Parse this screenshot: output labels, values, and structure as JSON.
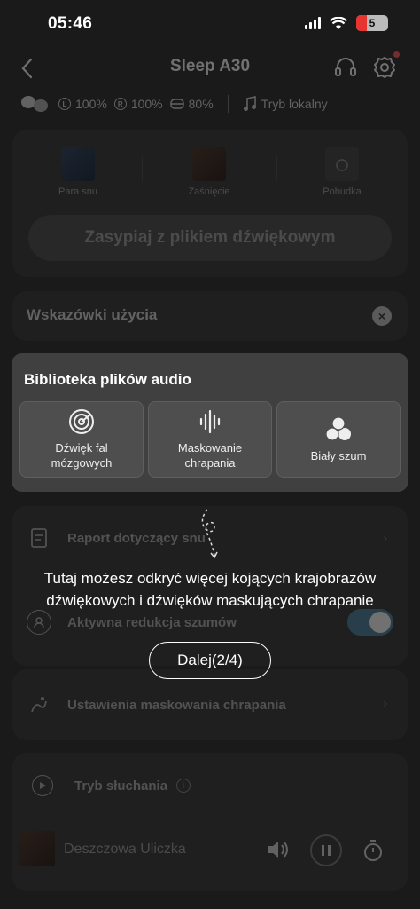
{
  "status": {
    "time": "05:46",
    "battery": "5"
  },
  "header": {
    "title": "Sleep A30"
  },
  "device": {
    "left": "100%",
    "right": "100%",
    "case": "80%",
    "mode": "Tryb lokalny"
  },
  "modes": [
    {
      "label": "Para snu"
    },
    {
      "label": "Zaśnięcie"
    },
    {
      "label": "Pobudka"
    }
  ],
  "cta": {
    "label": "Zasypiaj z plikiem dźwiękowym"
  },
  "tips": {
    "label": "Wskazówki użycia"
  },
  "library": {
    "title": "Biblioteka plików audio",
    "tiles": [
      {
        "label": "Dźwięk fal mózgowych",
        "icon": "brainwave-icon"
      },
      {
        "label": "Maskowanie chrapania",
        "icon": "soundwave-icon"
      },
      {
        "label": "Biały szum",
        "icon": "bubbles-icon"
      }
    ]
  },
  "rows": {
    "report": "Raport dotyczący snu",
    "anc": "Aktywna redukcja szumów",
    "masking": "Ustawienia maskowania chrapania",
    "listening": "Tryb słuchania"
  },
  "player": {
    "title": "Deszczowa Uliczka"
  },
  "guide": {
    "hint_line1": "Tutaj możesz odkryć więcej kojących krajobrazów",
    "hint_line2": "dźwiękowych i dźwięków maskujących chrapanie",
    "next": "Dalej(2/4)"
  }
}
